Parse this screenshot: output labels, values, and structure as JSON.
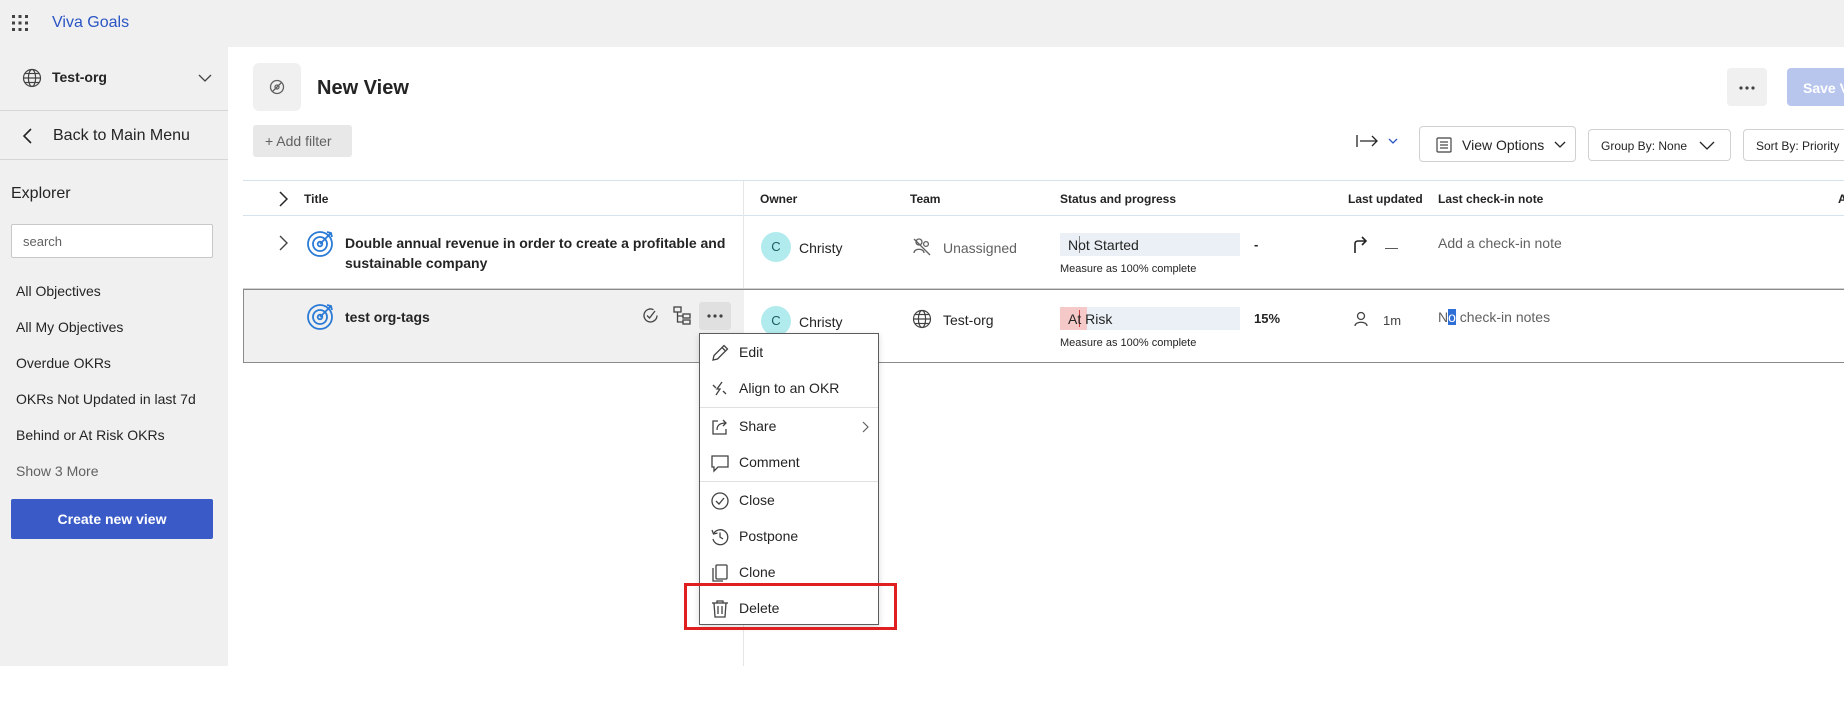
{
  "app": {
    "name": "Viva Goals"
  },
  "sidebar": {
    "org_name": "Test-org",
    "back_label": "Back to Main Menu",
    "explorer_title": "Explorer",
    "search_placeholder": "search",
    "items": [
      {
        "label": "All Objectives"
      },
      {
        "label": "All My Objectives"
      },
      {
        "label": "Overdue OKRs"
      },
      {
        "label": "OKRs Not Updated in last 7d"
      },
      {
        "label": "Behind or At Risk OKRs"
      }
    ],
    "show_more": "Show 3 More",
    "create_button": "Create new view"
  },
  "header": {
    "title": "New View",
    "save_button": "Save View",
    "add_filter": "+ Add filter",
    "view_options": "View Options",
    "group_by": "Group By:  None",
    "sort_by": "Sort By:  Priority"
  },
  "table": {
    "columns": {
      "title": "Title",
      "owner": "Owner",
      "team": "Team",
      "status": "Status and progress",
      "last_updated": "Last updated",
      "last_note": "Last check-in note",
      "extra": "A"
    },
    "rows": [
      {
        "title_line1": "Double annual revenue in order to create a profitable and",
        "title_line2": "sustainable company",
        "owner_initial": "C",
        "owner_name": "Christy",
        "team": "Unassigned",
        "status": "Not Started",
        "status_sub": "Measure as 100% complete",
        "progress": "-",
        "progress_fraction": 0,
        "last_updated": "—",
        "note": "Add a check-in note"
      },
      {
        "title_line1": "test org-tags",
        "owner_initial": "C",
        "owner_name": "Christy",
        "team": "Test-org",
        "status": "At Risk",
        "status_sub": "Measure as 100% complete",
        "progress": "15%",
        "progress_fraction": 0.15,
        "last_updated": "1m",
        "note_highlight": "o",
        "note_prefix": "N",
        "note_rest": " check-in notes"
      }
    ]
  },
  "context_menu": {
    "items": [
      {
        "label": "Edit"
      },
      {
        "label": "Align to an OKR"
      },
      {
        "label": "Share"
      },
      {
        "label": "Comment"
      },
      {
        "label": "Close"
      },
      {
        "label": "Postpone"
      },
      {
        "label": "Clone"
      },
      {
        "label": "Delete"
      }
    ]
  },
  "colors": {
    "brand": "#2b55c4",
    "primary_button": "#3a5bc7",
    "at_risk": "#f6c9c9",
    "avatar": "#b2ebee",
    "highlight_box": "#e02020"
  }
}
